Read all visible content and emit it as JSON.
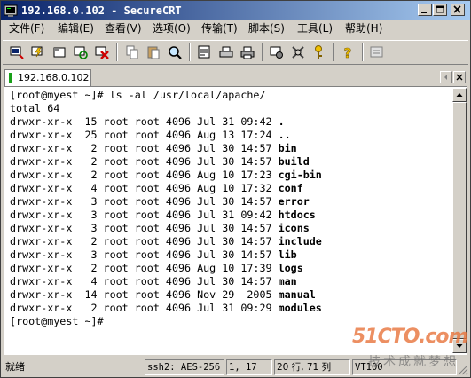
{
  "window": {
    "title": "192.168.0.102 - SecureCRT"
  },
  "menu": [
    {
      "label": "文件(F)"
    },
    {
      "label": "编辑(E)"
    },
    {
      "label": "查看(V)"
    },
    {
      "label": "选项(O)"
    },
    {
      "label": "传输(T)"
    },
    {
      "label": "脚本(S)"
    },
    {
      "label": "工具(L)"
    },
    {
      "label": "帮助(H)"
    }
  ],
  "toolbar": {
    "icons": [
      "connect-icon",
      "quick-connect-icon",
      "connect-in-tab-icon",
      "reconnect-icon",
      "disconnect-icon",
      "copy-icon",
      "paste-icon",
      "find-icon",
      "log-session-icon",
      "print-icon",
      "print-setup-icon",
      "session-options-icon",
      "global-options-icon",
      "keymap-icon",
      "help-icon",
      "sftp-icon"
    ]
  },
  "tabs": [
    {
      "label": "192.168.0.102",
      "status_color": "#18a018"
    }
  ],
  "terminal": {
    "command_line": "[root@myest ~]# ls -al /usr/local/apache/",
    "total_line": "total 64",
    "entries": [
      {
        "meta": "drwxr-xr-x  15 root root 4096 Jul 31 09:42 ",
        "name": "."
      },
      {
        "meta": "drwxr-xr-x  25 root root 4096 Aug 13 17:24 ",
        "name": ".."
      },
      {
        "meta": "drwxr-xr-x   2 root root 4096 Jul 30 14:57 ",
        "name": "bin"
      },
      {
        "meta": "drwxr-xr-x   2 root root 4096 Jul 30 14:57 ",
        "name": "build"
      },
      {
        "meta": "drwxr-xr-x   2 root root 4096 Aug 10 17:23 ",
        "name": "cgi-bin"
      },
      {
        "meta": "drwxr-xr-x   4 root root 4096 Aug 10 17:32 ",
        "name": "conf"
      },
      {
        "meta": "drwxr-xr-x   3 root root 4096 Jul 30 14:57 ",
        "name": "error"
      },
      {
        "meta": "drwxr-xr-x   3 root root 4096 Jul 31 09:42 ",
        "name": "htdocs"
      },
      {
        "meta": "drwxr-xr-x   3 root root 4096 Jul 30 14:57 ",
        "name": "icons"
      },
      {
        "meta": "drwxr-xr-x   2 root root 4096 Jul 30 14:57 ",
        "name": "include"
      },
      {
        "meta": "drwxr-xr-x   3 root root 4096 Jul 30 14:57 ",
        "name": "lib"
      },
      {
        "meta": "drwxr-xr-x   2 root root 4096 Aug 10 17:39 ",
        "name": "logs"
      },
      {
        "meta": "drwxr-xr-x   4 root root 4096 Jul 30 14:57 ",
        "name": "man"
      },
      {
        "meta": "drwxr-xr-x  14 root root 4096 Nov 29  2005 ",
        "name": "manual"
      },
      {
        "meta": "drwxr-xr-x   2 root root 4096 Jul 31 09:29 ",
        "name": "modules"
      }
    ],
    "prompt_line": "[root@myest ~]#"
  },
  "status": {
    "ready": "就绪",
    "protocol": "ssh2: AES-256",
    "cursor": "1,  17",
    "size": "20 行, 71 列",
    "emulation": "VT100"
  },
  "watermark": {
    "logo": "51CTO.com",
    "slogan": "技术成就梦想"
  }
}
